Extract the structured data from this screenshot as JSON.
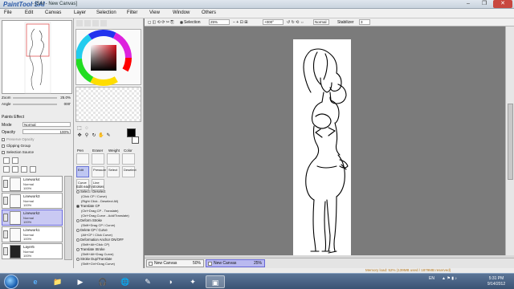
{
  "app": {
    "logo": "PaintTool SAI",
    "title": "- [SAI - New Canvas]",
    "window_buttons": [
      "–",
      "❐",
      "✕"
    ]
  },
  "menu": [
    "File",
    "Edit",
    "Canvas",
    "Layer",
    "Selection",
    "Filter",
    "View",
    "Window",
    "Others"
  ],
  "navigator": {
    "zoom_label": "Zoom",
    "zoom_value": "25.0%",
    "angle_label": "Angle",
    "angle_value": "000'"
  },
  "layer_props": {
    "paints_effect": "Paints Effect",
    "mode_label": "Mode",
    "mode_value": "Normal",
    "opacity_label": "Opacity",
    "opacity_value": "100%",
    "preserve_opacity": "Preserve Opacity",
    "clipping_group": "Clipping Group",
    "selection_source": "Selection Source"
  },
  "layers": [
    {
      "name": "Linework4",
      "mode": "Normal",
      "opacity": "100%",
      "selected": false
    },
    {
      "name": "Linework3",
      "mode": "Normal",
      "opacity": "100%",
      "selected": false
    },
    {
      "name": "Linework2",
      "mode": "Normal",
      "opacity": "100%",
      "selected": true
    },
    {
      "name": "Linework1",
      "mode": "Normal",
      "opacity": "100%",
      "selected": false
    },
    {
      "name": "Layer5",
      "mode": "Normal",
      "opacity": "100%",
      "selected": false
    }
  ],
  "tools": {
    "row1": [
      "Pen",
      "Eraser",
      "Weight",
      "Color"
    ],
    "row2": [
      "Edit",
      "Pressure",
      "Select",
      "Deselect"
    ],
    "row3": [
      "Curve",
      "Line"
    ],
    "active": "Edit"
  },
  "edit_options": {
    "header": "Edit each strokes",
    "items": [
      {
        "label": "Select / Deselect",
        "sub": [
          "(Click CP / Curve)",
          "(Right Click - Deselect All)"
        ],
        "checked": false
      },
      {
        "label": "Translate CP",
        "sub": [
          "(Ctrl+Drag CP - Translate)",
          "(Ctrl+Drag Curve - Add/Translate)"
        ],
        "checked": true
      },
      {
        "label": "Deform Stroke",
        "sub": [
          "(Shift+Drag CP / Curve)"
        ],
        "checked": false
      },
      {
        "label": "Delete CP / Curve",
        "sub": [
          "(Alt+CP / Click Curve)"
        ],
        "checked": false
      },
      {
        "label": "Deformation Anchor ON/OFF",
        "sub": [
          "(Shift+Alt+Click CP)"
        ],
        "checked": false
      },
      {
        "label": "Translate Stroke",
        "sub": [
          "(Shift+Alt+Drag Curve)"
        ],
        "checked": false
      },
      {
        "label": "Stroke Dup/Translate",
        "sub": [
          "(Shift+Ctrl+Drag Curve)"
        ],
        "checked": false
      }
    ]
  },
  "canvas_toolbar": {
    "selection_label": "Selection",
    "zoom": "25%",
    "angle": "+000°",
    "blend": "Normal",
    "stabilizer_label": "Stabilizer",
    "stabilizer_value": "3"
  },
  "canvas_tabs": [
    {
      "name": "New Canvas",
      "zoom": "50%",
      "active": false
    },
    {
      "name": "New Canvas",
      "zoom": "25%",
      "active": true
    }
  ],
  "status": {
    "memory": "Memory load: 52% (139MB used / 1879MB reserved)"
  },
  "taskbar": {
    "apps": [
      "e",
      "📁",
      "▶",
      "🎧",
      "🌐",
      "✎",
      "◑",
      "✦",
      "▣"
    ],
    "tray_lang": "EN",
    "time": "5:31 PM",
    "date": "9/14/2012"
  },
  "colors": {
    "accent": "#6767d6",
    "selected_layer": "#c9c9f3",
    "canvas_bg": "#7b7b7b"
  }
}
